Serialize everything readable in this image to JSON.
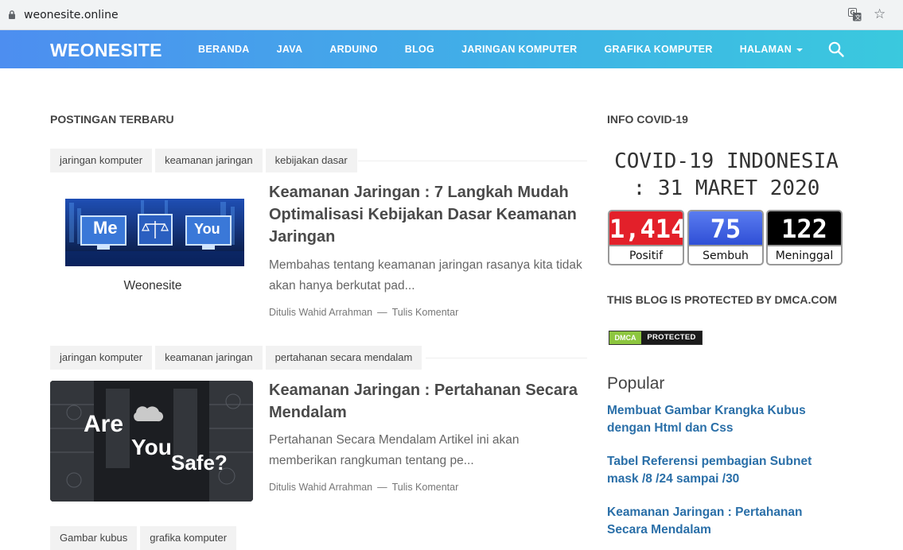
{
  "browser": {
    "url": "weonesite.online",
    "icons": [
      "lock-icon",
      "translate-icon",
      "star-icon"
    ]
  },
  "nav": {
    "brand": "WEONESITE",
    "items": [
      "BERANDA",
      "JAVA",
      "ARDUINO",
      "BLOG",
      "JARINGAN KOMPUTER",
      "GRAFIKA KOMPUTER",
      "HALAMAN"
    ],
    "search_icon": "search-icon"
  },
  "main": {
    "section_title": "POSTINGAN TERBARU",
    "posts": [
      {
        "tags": [
          "jaringan komputer",
          "keamanan jaringan",
          "kebijakan dasar"
        ],
        "title": "Keamanan Jaringan : 7 Langkah Mudah Optimalisasi Kebijakan Dasar Keamanan Jaringan",
        "excerpt": "Membahas tentang keamanan jaringan rasanya kita tidak akan hanya berkutat pad...",
        "author": "Ditulis Wahid Arrahman",
        "comment": "Tulis Komentar",
        "thumb_text": [
          "Me",
          "You"
        ],
        "thumb_caption": "Weonesite"
      },
      {
        "tags": [
          "jaringan komputer",
          "keamanan jaringan",
          "pertahanan secara mendalam"
        ],
        "title": "Keamanan Jaringan : Pertahanan Secara Mendalam",
        "excerpt": "Pertahanan Secara Mendalam Artikel ini akan memberikan rangkuman tentang pe...",
        "author": "Ditulis Wahid Arrahman",
        "comment": "Tulis Komentar",
        "thumb_text": [
          "Are",
          "You",
          "Safe?"
        ]
      },
      {
        "tags": [
          "Gambar kubus",
          "grafika komputer"
        ]
      }
    ]
  },
  "sidebar": {
    "covid_section_title": "INFO COVID-19",
    "covid_title_line1": "COVID-19 INDONESIA",
    "covid_title_line2": ": 31 MARET 2020",
    "covid_stats": [
      {
        "value": "1,414",
        "label": "Positif",
        "color": "#e3202a"
      },
      {
        "value": "75",
        "label": "Sembuh",
        "color": "#3f5fe0"
      },
      {
        "value": "122",
        "label": "Meninggal",
        "color": "#000000"
      }
    ],
    "dmca_section_title": "THIS BLOG IS PROTECTED BY DMCA.COM",
    "dmca_badge_left": "DMCA",
    "dmca_badge_right": "PROTECTED",
    "popular_title": "Popular",
    "popular_links": [
      "Membuat Gambar Krangka Kubus dengan Html dan Css",
      "Tabel Referensi pembagian Subnet mask /8 /24 sampai /30",
      "Keamanan Jaringan : Pertahanan Secara Mendalam"
    ]
  }
}
